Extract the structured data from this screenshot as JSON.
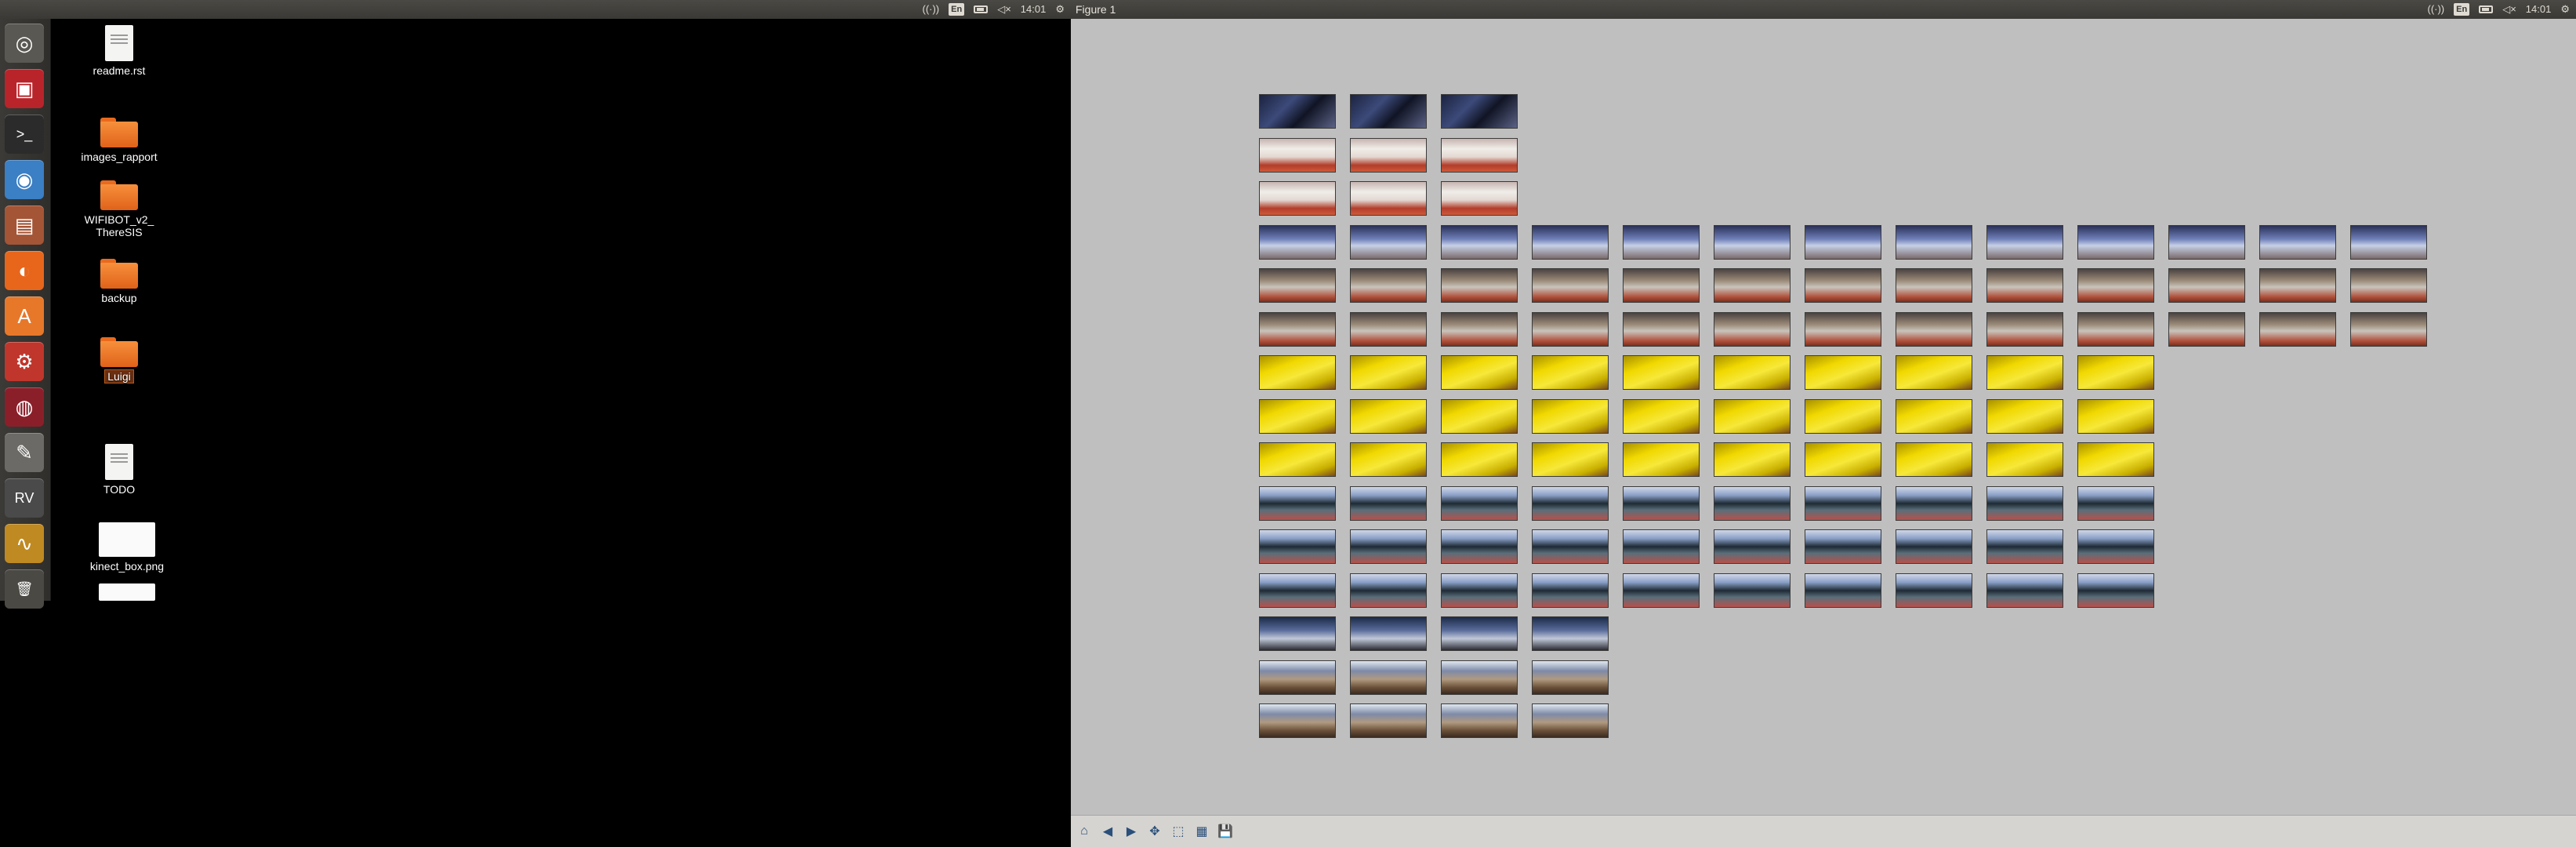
{
  "left_panel": {
    "keyboard": "En",
    "time": "14:01"
  },
  "right_panel": {
    "window_title": "Figure 1",
    "keyboard": "En",
    "time": "14:01"
  },
  "launcher": {
    "items": [
      {
        "name": "dash-button",
        "glyph": "◎",
        "bg": "#5a5852"
      },
      {
        "name": "app-red-button",
        "glyph": "▣",
        "bg": "#b8242a"
      },
      {
        "name": "terminal-button",
        "glyph": ">_",
        "bg": "#2b2b2b"
      },
      {
        "name": "chromium-button",
        "glyph": "◉",
        "bg": "#3b7fc4"
      },
      {
        "name": "files-button",
        "glyph": "▤",
        "bg": "#a45536"
      },
      {
        "name": "firefox-button",
        "glyph": "◐",
        "bg": "#e8661b"
      },
      {
        "name": "software-center-button",
        "glyph": "A",
        "bg": "#e7782a"
      },
      {
        "name": "system-settings-button",
        "glyph": "⚙",
        "bg": "#c0362c"
      },
      {
        "name": "app-dark-button",
        "glyph": "◍",
        "bg": "#8a1f2a"
      },
      {
        "name": "text-editor-button",
        "glyph": "✎",
        "bg": "#6b6a66"
      },
      {
        "name": "rviz-button",
        "glyph": "RV",
        "bg": "#4a4a4a"
      },
      {
        "name": "scope-button",
        "glyph": "∿",
        "bg": "#c08a22"
      },
      {
        "name": "trash-button",
        "glyph": "🗑",
        "bg": "#4a4944"
      }
    ]
  },
  "desktop": {
    "icons": [
      {
        "name": "readme-file-icon",
        "type": "doc",
        "label": "readme.rst"
      },
      {
        "name": "images-rapport-folder-icon",
        "type": "folder",
        "label": "images_rapport"
      },
      {
        "name": "wifibot-folder-icon",
        "type": "folder",
        "label": "WIFIBOT_v2_\nThereSIS"
      },
      {
        "name": "backup-folder-icon",
        "type": "folder",
        "label": "backup"
      },
      {
        "name": "luigi-folder-icon",
        "type": "folder",
        "label": "Luigi"
      },
      {
        "name": "todo-file-icon",
        "type": "doc",
        "label": "TODO"
      },
      {
        "name": "kinect-box-file-icon",
        "type": "img",
        "label": "kinect_box.png"
      },
      {
        "name": "image-file-icon",
        "type": "img",
        "label": ""
      }
    ]
  },
  "figure": {
    "row_counts": [
      3,
      3,
      3,
      13,
      13,
      13,
      10,
      10,
      10,
      10,
      10,
      10,
      4,
      4,
      4
    ],
    "row_themes": [
      "dark",
      "fan",
      "fan",
      "blue",
      "kitchen",
      "kitchen",
      "yellow",
      "yellow",
      "yellow",
      "office",
      "office",
      "office",
      "blue2",
      "shelf",
      "shelf"
    ],
    "toolbar": [
      {
        "name": "home-icon",
        "glyph": "⌂"
      },
      {
        "name": "back-icon",
        "glyph": "◀"
      },
      {
        "name": "forward-icon",
        "glyph": "▶"
      },
      {
        "name": "pan-icon",
        "glyph": "✥"
      },
      {
        "name": "zoom-icon",
        "glyph": "⬚"
      },
      {
        "name": "configure-subplots-icon",
        "glyph": "▦"
      },
      {
        "name": "save-icon",
        "glyph": "💾"
      }
    ]
  },
  "colors": {
    "panel_bg": "#3a3935",
    "figure_bg": "#bfbfbf",
    "folder_orange": "#f7903c"
  }
}
